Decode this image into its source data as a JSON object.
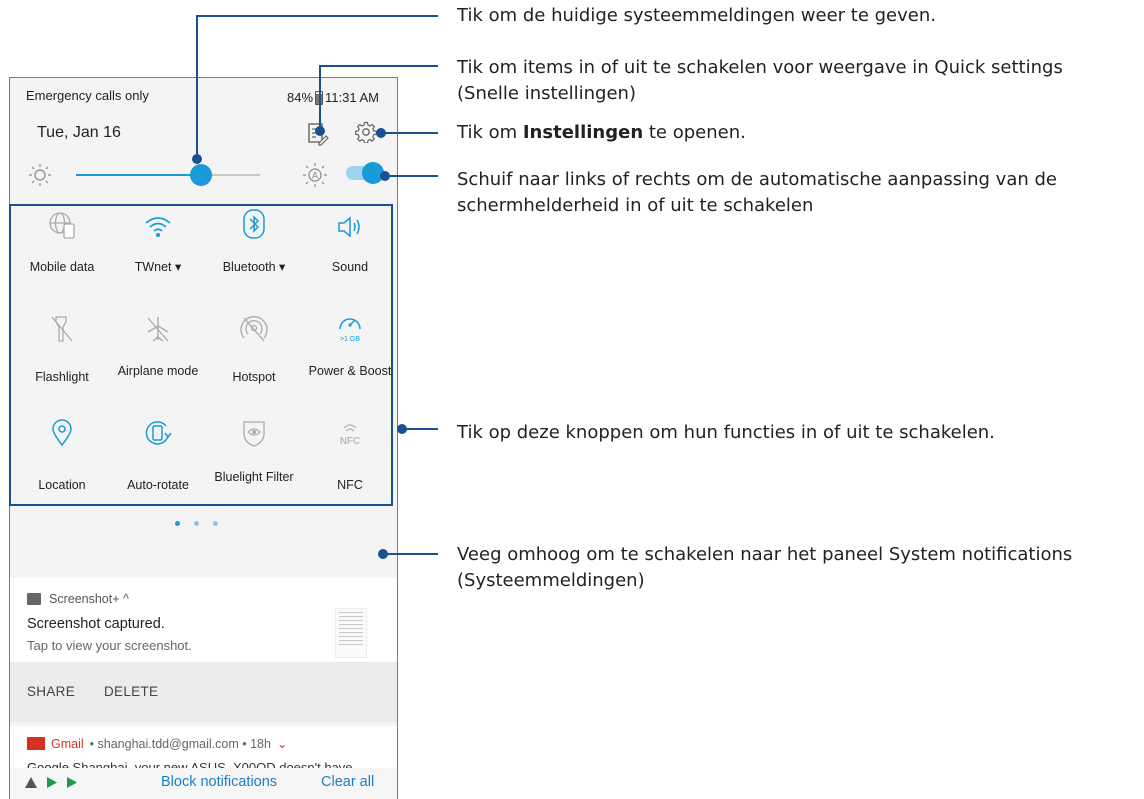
{
  "status_bar": {
    "left": "Emergency calls only",
    "battery": "84%",
    "time": "11:31 AM"
  },
  "date": "Tue, Jan 16",
  "tiles": [
    {
      "label": "Mobile data",
      "icon": "globe-sim-icon"
    },
    {
      "label": "TWnet ▾",
      "icon": "wifi-icon"
    },
    {
      "label": "Bluetooth ▾",
      "icon": "bluetooth-icon"
    },
    {
      "label": "Sound",
      "icon": "speaker-icon"
    },
    {
      "label": "Flashlight",
      "icon": "flashlight-icon"
    },
    {
      "label": "Airplane mode",
      "icon": "airplane-icon"
    },
    {
      "label": "Hotspot",
      "icon": "hotspot-icon"
    },
    {
      "label": "Power & Boost",
      "icon": "gauge-icon"
    },
    {
      "label": "Location",
      "icon": "location-icon"
    },
    {
      "label": "Auto-rotate",
      "icon": "rotate-icon"
    },
    {
      "label": "Bluelight Filter",
      "icon": "eye-shield-icon"
    },
    {
      "label": "NFC",
      "icon": "nfc-icon"
    }
  ],
  "boost_badge": ">1 GB",
  "nfc_glyph": "NFC",
  "notification_screenshot": {
    "app": "Screenshot+ ^",
    "title": "Screenshot captured.",
    "subtitle": "Tap to view your screenshot.",
    "share": "SHARE",
    "delete": "DELETE"
  },
  "notification_gmail": {
    "app": "Gmail",
    "account": "• shanghai.tdd@gmail.com • 18h",
    "peek_from": "Google",
    "peek_text": "Shanghai, your new ASUS_X00QD doesn't have"
  },
  "bottom_bar": {
    "block": "Block notifications",
    "clear": "Clear all"
  },
  "annotations": {
    "a1": "Tik om de huidige systeemmeldingen weer te geven.",
    "a2_line1": "Tik om items in of uit te schakelen voor weergave in Quick settings",
    "a2_line2": "(Snelle instellingen)",
    "a3_pre": "Tik om ",
    "a3_bold": "Instellingen",
    "a3_post": " te openen.",
    "a4_line1": "Schuif naar links of rechts om de automatische aanpassing van de",
    "a4_line2": "schermhelderheid in of uit te schakelen",
    "a5": "Tik op deze knoppen om hun functies in of uit te schakelen.",
    "a6_line1": "Veeg omhoog om te schakelen naar het paneel System notifications",
    "a6_line2": "(Systeemmeldingen)"
  },
  "colors": {
    "accent": "#1a9ad6",
    "callout": "#1a4f92",
    "action_link": "#1a7fc4",
    "gmail_red": "#d93025"
  },
  "brightness_level": 0.68,
  "auto_brightness_on": true,
  "page_dots": {
    "count": 3,
    "active": 0
  }
}
